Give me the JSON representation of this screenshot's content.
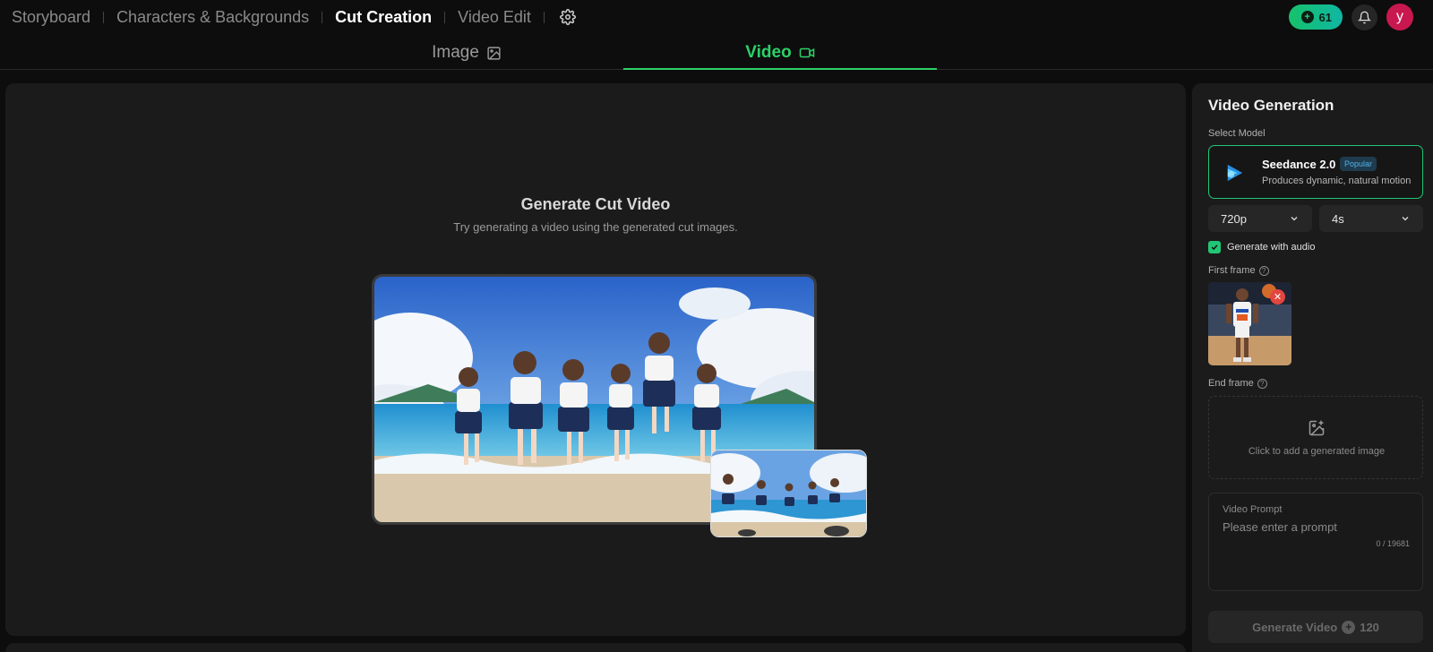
{
  "nav": {
    "items": [
      {
        "label": "Storyboard"
      },
      {
        "label": "Characters & Backgrounds"
      },
      {
        "label": "Cut Creation"
      },
      {
        "label": "Video Edit"
      }
    ]
  },
  "header": {
    "credits": "61",
    "avatar_initial": "y"
  },
  "tabs": {
    "image_label": "Image",
    "video_label": "Video"
  },
  "main": {
    "title": "Generate Cut Video",
    "subtitle": "Try generating a video using the generated cut images."
  },
  "panel": {
    "title": "Video Generation",
    "select_model_label": "Select Model",
    "model": {
      "name": "Seedance 2.0",
      "badge": "Popular",
      "description": "Produces dynamic, natural motion"
    },
    "resolution": "720p",
    "duration": "4s",
    "audio_label": "Generate with audio",
    "first_frame_label": "First frame",
    "end_frame_label": "End frame",
    "end_frame_hint": "Click to add a generated image",
    "prompt_label": "Video Prompt",
    "prompt_placeholder": "Please enter a prompt",
    "prompt_count": "0 / 19681",
    "generate_label": "Generate Video",
    "generate_cost": "120"
  },
  "colors": {
    "accent": "#2bd16a",
    "badge": "#4fb1e8",
    "avatar": "#c8184f",
    "danger": "#e3453f"
  }
}
